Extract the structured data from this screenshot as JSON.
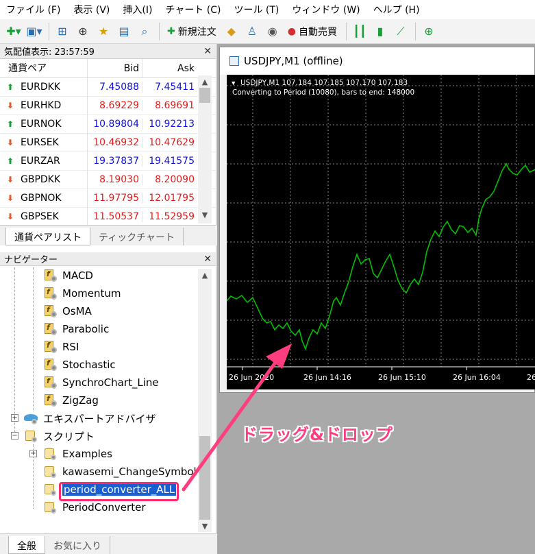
{
  "menu": [
    "ファイル (F)",
    "表示 (V)",
    "挿入(I)",
    "チャート (C)",
    "ツール (T)",
    "ウィンドウ (W)",
    "ヘルプ (H)"
  ],
  "toolbar": {
    "new_order": "新規注文",
    "auto_trade": "自動売買"
  },
  "market_watch": {
    "title": "気配値表示: 23:57:59",
    "col_symbol": "通貨ペア",
    "col_bid": "Bid",
    "col_ask": "Ask",
    "rows": [
      {
        "symbol": "EURDKK",
        "bid": "7.45088",
        "ask": "7.45411",
        "dir": "up"
      },
      {
        "symbol": "EURHKD",
        "bid": "8.69229",
        "ask": "8.69691",
        "dir": "down"
      },
      {
        "symbol": "EURNOK",
        "bid": "10.89804",
        "ask": "10.92213",
        "dir": "up"
      },
      {
        "symbol": "EURSEK",
        "bid": "10.46932",
        "ask": "10.47629",
        "dir": "down"
      },
      {
        "symbol": "EURZAR",
        "bid": "19.37837",
        "ask": "19.41575",
        "dir": "up"
      },
      {
        "symbol": "GBPDKK",
        "bid": "8.19030",
        "ask": "8.20090",
        "dir": "down"
      },
      {
        "symbol": "GBPNOK",
        "bid": "11.97795",
        "ask": "12.01795",
        "dir": "down"
      },
      {
        "symbol": "GBPSEK",
        "bid": "11.50537",
        "ask": "11.52959",
        "dir": "down"
      }
    ],
    "tab_active": "通貨ペアリスト",
    "tab_inactive": "ティックチャート"
  },
  "navigator": {
    "title": "ナビゲーター",
    "indicators": [
      "MACD",
      "Momentum",
      "OsMA",
      "Parabolic",
      "RSI",
      "Stochastic",
      "SynchroChart_Line",
      "ZigZag"
    ],
    "expert_advisors": "エキスパートアドバイザ",
    "scripts": "スクリプト",
    "script_items": [
      "Examples",
      "kawasemi_ChangeSymbol",
      "period_converter_ALL",
      "PeriodConverter"
    ],
    "tab_active": "全般",
    "tab_inactive": "お気に入り"
  },
  "chart": {
    "window_title": "USDJPY,M1 (offline)",
    "info_line": "USDJPY,M1  107.184 107.185 107.170 107.183",
    "converting_line": "Converting to Period (10080), bars to end:  148000",
    "time_labels": [
      "26 Jun 2020",
      "26 Jun 14:16",
      "26 Jun 15:10",
      "26 Jun 16:04",
      "26"
    ],
    "line_color": "#00c000",
    "background_color": "#000000"
  },
  "annotation": {
    "text": "ドラッグ&ドロップ",
    "color": "#ff3d7f"
  }
}
